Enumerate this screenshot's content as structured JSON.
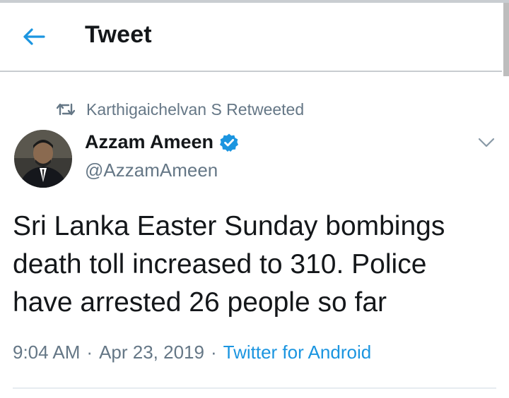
{
  "colors": {
    "accent": "#1b95e0",
    "text_primary": "#14171a",
    "text_secondary": "#657786",
    "divider": "#e6ecf0"
  },
  "header": {
    "back_icon": "arrow-left-icon",
    "title": "Tweet"
  },
  "retweet": {
    "icon": "retweet-icon",
    "text": "Karthigaichelvan S Retweeted"
  },
  "tweet": {
    "author_name": "Azzam Ameen",
    "verified_icon": "verified-badge-icon",
    "handle": "@AzzamAmeen",
    "menu_icon": "chevron-down-icon",
    "text": "Sri Lanka Easter Sunday bombings death toll increased to 310. Police have arrested 26 people so far",
    "time": "9:04 AM",
    "separator": "·",
    "date": "Apr 23, 2019",
    "source": "Twitter for Android"
  }
}
